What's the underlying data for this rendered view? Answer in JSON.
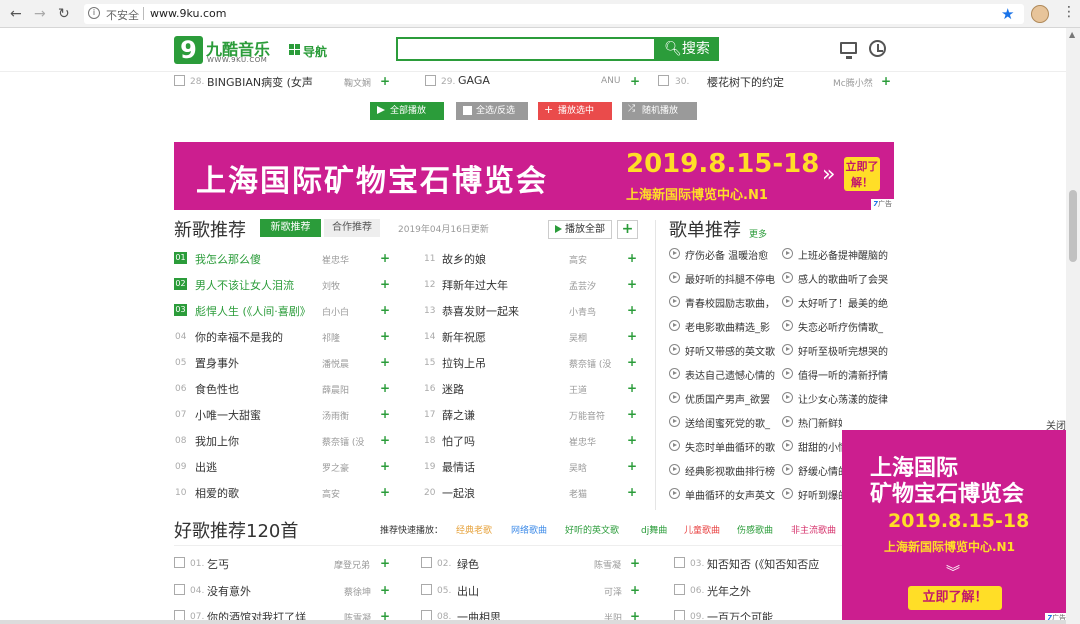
{
  "browser": {
    "security_label": "不安全",
    "url": "www.9ku.com",
    "icons": [
      "back-arrow-icon",
      "forward-arrow-icon",
      "reload-icon",
      "info-icon",
      "star-icon",
      "avatar",
      "menu-dots-icon"
    ]
  },
  "site": {
    "logo_digit": "9",
    "logo_name": "九酷音乐",
    "logo_domain": "WWW.9KU.COM",
    "nav_label": "导航",
    "search_placeholder": "",
    "search_button": "搜索"
  },
  "top_row": [
    {
      "num": "28.",
      "title": "BINGBIAN病变 (女声",
      "artist": "鞠文娴"
    },
    {
      "num": "29.",
      "title": "GAGA",
      "artist": "ANU"
    },
    {
      "num": "30.",
      "title": "樱花树下的约定",
      "artist": "Mc腾小然"
    }
  ],
  "actions": {
    "play_all": "全部播放",
    "select_all": "全选/反选",
    "play_selected": "播放选中",
    "random_play": "随机播放"
  },
  "banner": {
    "title": "上海国际矿物宝石博览会",
    "date": "2019.8.15-18",
    "location": "上海新国际博览中心.N1",
    "cta": "立即了解！",
    "ad_label": "广告"
  },
  "new_songs": {
    "title": "新歌推荐",
    "tab_new": "新歌推荐",
    "tab_coop": "合作推荐",
    "date": "2019年04月16日更新",
    "play_all": "播放全部",
    "left": [
      {
        "rank": "01",
        "title": "我怎么那么傻",
        "artist": "崔忠华"
      },
      {
        "rank": "02",
        "title": "男人不该让女人泪流",
        "artist": "刘牧"
      },
      {
        "rank": "03",
        "title": "彪悍人生 (《人间·喜剧》",
        "artist": "白小白"
      },
      {
        "rank": "04",
        "title": "你的幸福不是我的",
        "artist": "祁隆"
      },
      {
        "rank": "05",
        "title": "置身事外",
        "artist": "潘悦晨"
      },
      {
        "rank": "06",
        "title": "食色性也",
        "artist": "薛晨阳"
      },
      {
        "rank": "07",
        "title": "小唯一大甜蜜",
        "artist": "汤雨衡"
      },
      {
        "rank": "08",
        "title": "我加上你",
        "artist": "蔡奈镭 (没"
      },
      {
        "rank": "09",
        "title": "出逃",
        "artist": "罗之豪"
      },
      {
        "rank": "10",
        "title": "相爱的歌",
        "artist": "高安"
      }
    ],
    "right": [
      {
        "rank": "11",
        "title": "故乡的娘",
        "artist": "高安"
      },
      {
        "rank": "12",
        "title": "拜新年过大年",
        "artist": "孟芸汐"
      },
      {
        "rank": "13",
        "title": "恭喜发财一起来",
        "artist": "小青鸟"
      },
      {
        "rank": "14",
        "title": "新年祝愿",
        "artist": "吴桐"
      },
      {
        "rank": "15",
        "title": "拉钩上吊",
        "artist": "蔡奈镭 (没"
      },
      {
        "rank": "16",
        "title": "迷路",
        "artist": "王道"
      },
      {
        "rank": "17",
        "title": "薛之谦",
        "artist": "万能音符"
      },
      {
        "rank": "18",
        "title": "怕了吗",
        "artist": "崔忠华"
      },
      {
        "rank": "19",
        "title": "最情话",
        "artist": "吴晗"
      },
      {
        "rank": "20",
        "title": "一起浪",
        "artist": "老猫"
      }
    ]
  },
  "playlists": {
    "title": "歌单推荐",
    "more": "更多",
    "left": [
      "疗伤必备 温暖治愈",
      "最好听的抖腿不停电",
      "青春校园励志歌曲，",
      "老电影歌曲精选_影",
      "好听又带感的英文歌",
      "表达自己遗憾心情的",
      "优质国产男声_欲罢",
      "送给闺蜜死党的歌_",
      "失恋时单曲循环的歌",
      "经典影视歌曲排行榜",
      "单曲循环的女声英文"
    ],
    "right": [
      "上班必备提神醒脑的",
      "感人的歌曲听了会哭",
      "太好听了！最美的绝",
      "失恋必听疗伤情歌_",
      "好听至极听完想哭的",
      "值得一听的清新抒情",
      "让少女心荡漾的旋律",
      "热门新鲜好歌合集",
      "甜甜的小情歌",
      "舒缓心情的",
      "好听到爆的"
    ]
  },
  "good_songs": {
    "title": "好歌推荐120首",
    "quick_label": "推荐快速播放：",
    "quick": [
      "经典老歌",
      "网络歌曲",
      "好听的英文歌",
      "dj舞曲",
      "儿童歌曲",
      "伤感歌曲",
      "非主流歌曲"
    ],
    "quick_colors": [
      "#e6a23c",
      "#3e8be8",
      "#2b9c3a",
      "#2b9c3a",
      "#e84343",
      "#2b9c3a",
      "#d6336c"
    ],
    "row1": [
      {
        "num": "01.",
        "title": "乞丐",
        "artist": "摩登兄弟"
      },
      {
        "num": "02.",
        "title": "绿色",
        "artist": "陈雪凝"
      },
      {
        "num": "03.",
        "title": "知否知否 (《知否知否应",
        "artist": ""
      }
    ],
    "row2": [
      {
        "num": "04.",
        "title": "没有意外",
        "artist": "蔡徐坤"
      },
      {
        "num": "05.",
        "title": "出山",
        "artist": "可泽"
      },
      {
        "num": "06.",
        "title": "光年之外",
        "artist": ""
      }
    ],
    "row3": [
      {
        "num": "07.",
        "title": "你的酒馆对我打了烊",
        "artist": "陈雪凝"
      },
      {
        "num": "08.",
        "title": "一曲相思",
        "artist": "半阳"
      },
      {
        "num": "09.",
        "title": "一百万个可能",
        "artist": ""
      }
    ]
  },
  "popup": {
    "close": "关闭",
    "line1": "上海国际",
    "line2": "矿物宝石博览会",
    "date": "2019.8.15-18",
    "location": "上海新国际博览中心.N1",
    "cta": "立即了解！",
    "ad_label": "广告"
  }
}
